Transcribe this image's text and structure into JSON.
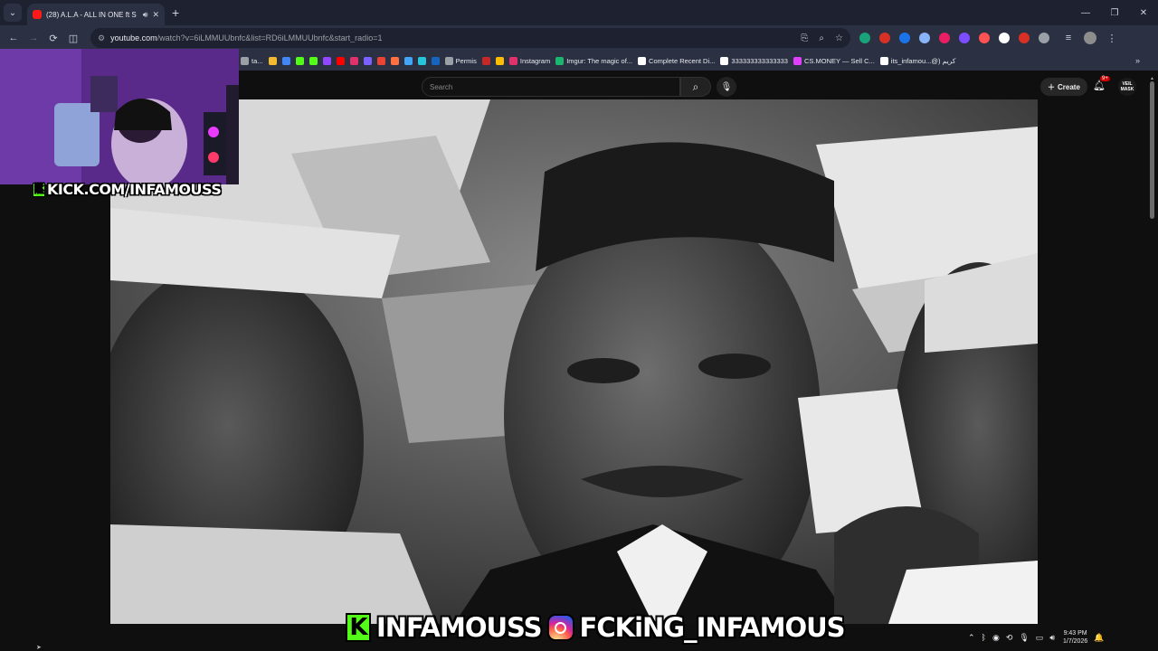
{
  "browser": {
    "tab": {
      "title": "(28) A.L.A - ALL IN ONE ft S",
      "favicon": "youtube-icon",
      "audio": "speaker-icon",
      "close": "✕"
    },
    "new_tab": "+",
    "window_controls": [
      "—",
      "❐",
      "✕"
    ],
    "nav": {
      "back": "←",
      "forward": "→",
      "reload": "⟳",
      "split": "◫"
    },
    "address": {
      "host": "youtube.com",
      "path": "/watch?v=6iLMMUUbnfc&list=RD6iLMMUUbnfc&start_radio=1"
    },
    "omnibox_icons": [
      "install-icon",
      "zoom-icon",
      "bookmark-star-icon"
    ],
    "extensions": [
      "#1aa37a",
      "#d93025",
      "#1a73e8",
      "#8ab4f8",
      "#e91e63",
      "#7c4dff",
      "#ff5252",
      "#ffffff",
      "#d93025",
      "#9aa0a6"
    ],
    "bookmarks": [
      {
        "label": "ta...",
        "color": "#9aa0a6"
      },
      {
        "label": "",
        "color": "#f3ba2f"
      },
      {
        "label": "",
        "color": "#4285f4"
      },
      {
        "label": "",
        "color": "#53fc18"
      },
      {
        "label": "",
        "color": "#53fc18"
      },
      {
        "label": "",
        "color": "#9146ff"
      },
      {
        "label": "",
        "color": "#ff0000"
      },
      {
        "label": "",
        "color": "#e1306c"
      },
      {
        "label": "",
        "color": "#7b61ff"
      },
      {
        "label": "",
        "color": "#ea4335"
      },
      {
        "label": "",
        "color": "#ff7043"
      },
      {
        "label": "",
        "color": "#42a5f5"
      },
      {
        "label": "",
        "color": "#26c6da"
      },
      {
        "label": "",
        "color": "#1565c0"
      },
      {
        "label": "Permis",
        "color": "#9aa0a6"
      },
      {
        "label": "",
        "color": "#c62828"
      },
      {
        "label": "",
        "color": "#fbbc04"
      },
      {
        "label": "Instagram",
        "color": "#e1306c"
      },
      {
        "label": "Imgur: The magic of...",
        "color": "#1bb76e"
      },
      {
        "label": "Complete Recent Di...",
        "color": "#ffffff"
      },
      {
        "label": "333333333333333",
        "color": "#ffffff"
      },
      {
        "label": "CS.MONEY — Sell C...",
        "color": "#e040fb"
      },
      {
        "label": "its_infamou...@) كريم",
        "color": "#ffffff"
      }
    ],
    "bookmarks_more": "»"
  },
  "youtube": {
    "search_placeholder": "Search",
    "create_label": "Create",
    "notif_count": "9+",
    "avatar_text": "VEIL MASK"
  },
  "stream": {
    "webcam_handle": "KICK.COM/INFAMOUSS",
    "kick_letter": "K",
    "kick_name": "INFAMOUSS",
    "ig_name": "FCKiNG_INFAMOUS"
  },
  "taskbar": {
    "tray_icons": [
      "chevron-up-icon",
      "bluetooth-icon",
      "discord-icon",
      "sync-icon",
      "mic-icon",
      "network-icon",
      "volume-icon"
    ],
    "time": "9:43 PM",
    "date": "1/7/2026",
    "notification": "🔔"
  }
}
